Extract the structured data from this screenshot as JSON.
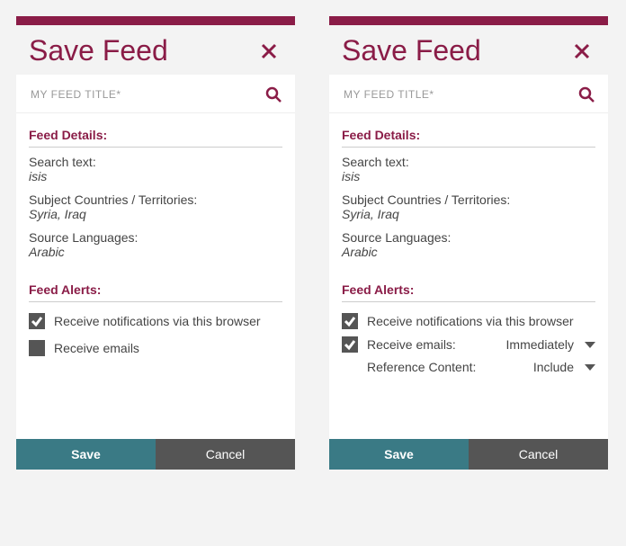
{
  "panelA": {
    "title": "Save Feed",
    "search_placeholder": "MY FEED TITLE*",
    "details_heading": "Feed Details:",
    "search_text_label": "Search text:",
    "search_text_value": "isis",
    "countries_label": "Subject Countries / Territories:",
    "countries_value": "Syria, Iraq",
    "languages_label": "Source Languages:",
    "languages_value": "Arabic",
    "alerts_heading": "Feed Alerts:",
    "notify_label": "Receive notifications via this browser",
    "emails_label": "Receive emails",
    "save_label": "Save",
    "cancel_label": "Cancel"
  },
  "panelB": {
    "title": "Save Feed",
    "search_placeholder": "MY FEED TITLE*",
    "details_heading": "Feed Details:",
    "search_text_label": "Search text:",
    "search_text_value": "isis",
    "countries_label": "Subject Countries / Territories:",
    "countries_value": "Syria, Iraq",
    "languages_label": "Source Languages:",
    "languages_value": "Arabic",
    "alerts_heading": "Feed Alerts:",
    "notify_label": "Receive notifications via this browser",
    "emails_label": "Receive emails:",
    "email_freq_value": "Immediately",
    "ref_content_label": "Reference Content:",
    "ref_content_value": "Include",
    "save_label": "Save",
    "cancel_label": "Cancel"
  }
}
